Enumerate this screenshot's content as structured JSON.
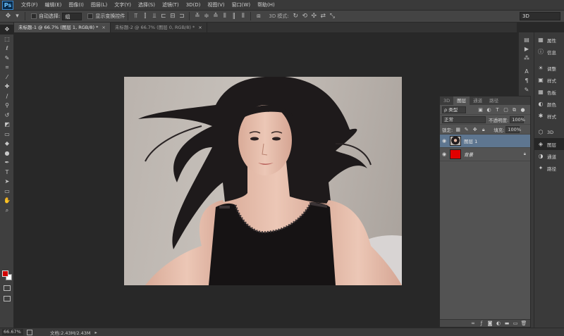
{
  "app": {
    "logo": "Ps"
  },
  "menu": [
    "文件(F)",
    "编辑(E)",
    "图像(I)",
    "图层(L)",
    "文字(Y)",
    "选择(S)",
    "滤镜(T)",
    "3D(D)",
    "视图(V)",
    "窗口(W)",
    "帮助(H)"
  ],
  "options": {
    "auto_select_label": "自动选择:",
    "auto_select_value": "组",
    "show_transform_label": "显示变换控件",
    "mode_3d_label": "3D 模式:",
    "workspace": "3D"
  },
  "tabs": [
    {
      "label": "未标题-1 @ 66.7% (图层 1, RGB/8) *",
      "active": true,
      "close": "×"
    },
    {
      "label": "未标题-2 @ 66.7% (图层 0, RGB/8) *",
      "active": false,
      "close": "×"
    }
  ],
  "toolbar": {
    "icons": [
      "move-icon",
      "marquee-icon",
      "lasso-icon",
      "quick-select-icon",
      "crop-icon",
      "eyedropper-icon",
      "healing-brush-icon",
      "brush-icon",
      "clone-stamp-icon",
      "history-brush-icon",
      "eraser-icon",
      "gradient-icon",
      "blur-icon",
      "dodge-icon",
      "pen-icon",
      "type-icon",
      "path-select-icon",
      "rectangle-icon",
      "hand-icon",
      "zoom-icon"
    ],
    "glyphs": [
      "✥",
      "⬚",
      "ℓ",
      "✎",
      "⌗",
      "⁄",
      "✚",
      "∕",
      "⚲",
      "↺",
      "◩",
      "▭",
      "◆",
      "●",
      "✒",
      "T",
      "➤",
      "▭",
      "✋",
      "⌕"
    ],
    "foreground_color": "#d00000",
    "background_color": "#ffffff"
  },
  "dock_col1": {
    "icons": [
      "history-icon",
      "actions-icon",
      "brush-presets-icon",
      "character-icon",
      "paragraph-icon",
      "tool-presets-icon",
      "info-icon",
      "navigator-icon",
      "clone-source-icon",
      "notes-icon"
    ],
    "glyphs": [
      "▤",
      "▶",
      "⁂",
      "A",
      "¶",
      "✎",
      "ℹ",
      "⌖",
      "⧉",
      "✉"
    ]
  },
  "dock_col2": {
    "items": [
      {
        "label": "属性",
        "icon": "properties-icon",
        "glyph": "▦"
      },
      {
        "label": "信息",
        "icon": "info-icon",
        "glyph": "ⓘ"
      },
      {
        "label": "调整",
        "icon": "adjustments-icon",
        "glyph": "☀"
      },
      {
        "label": "样式",
        "icon": "styles-icon",
        "glyph": "▣"
      },
      {
        "label": "色板",
        "icon": "swatches-icon",
        "glyph": "▦"
      },
      {
        "label": "颜色",
        "icon": "color-icon",
        "glyph": "◐"
      },
      {
        "label": "样式",
        "icon": "styles-alt-icon",
        "glyph": "✱"
      },
      {
        "label": "3D",
        "icon": "3d-icon",
        "glyph": "⬡"
      },
      {
        "label": "图层",
        "icon": "layers-icon",
        "glyph": "◈",
        "active": true
      },
      {
        "label": "通道",
        "icon": "channels-icon",
        "glyph": "◑"
      },
      {
        "label": "路径",
        "icon": "paths-icon",
        "glyph": "✦"
      }
    ]
  },
  "layers_panel": {
    "tabs": [
      {
        "label": "3D",
        "active": false
      },
      {
        "label": "图层",
        "active": true
      },
      {
        "label": "通道",
        "active": false
      },
      {
        "label": "路径",
        "active": false
      }
    ],
    "filter_kind": "ρ 类型",
    "blend_mode": "正常",
    "opacity_label": "不透明度:",
    "opacity_value": "100%",
    "lock_label": "锁定:",
    "fill_label": "填充:",
    "fill_value": "100%",
    "layers": [
      {
        "name": "图层 1",
        "selected": true,
        "italic": false,
        "thumb": "photo"
      },
      {
        "name": "背景",
        "selected": false,
        "italic": true,
        "thumb": "#e10000",
        "locked": true
      }
    ]
  },
  "status": {
    "zoom": "66.67%",
    "doc_info": "文档:2.43M/2.43M"
  }
}
